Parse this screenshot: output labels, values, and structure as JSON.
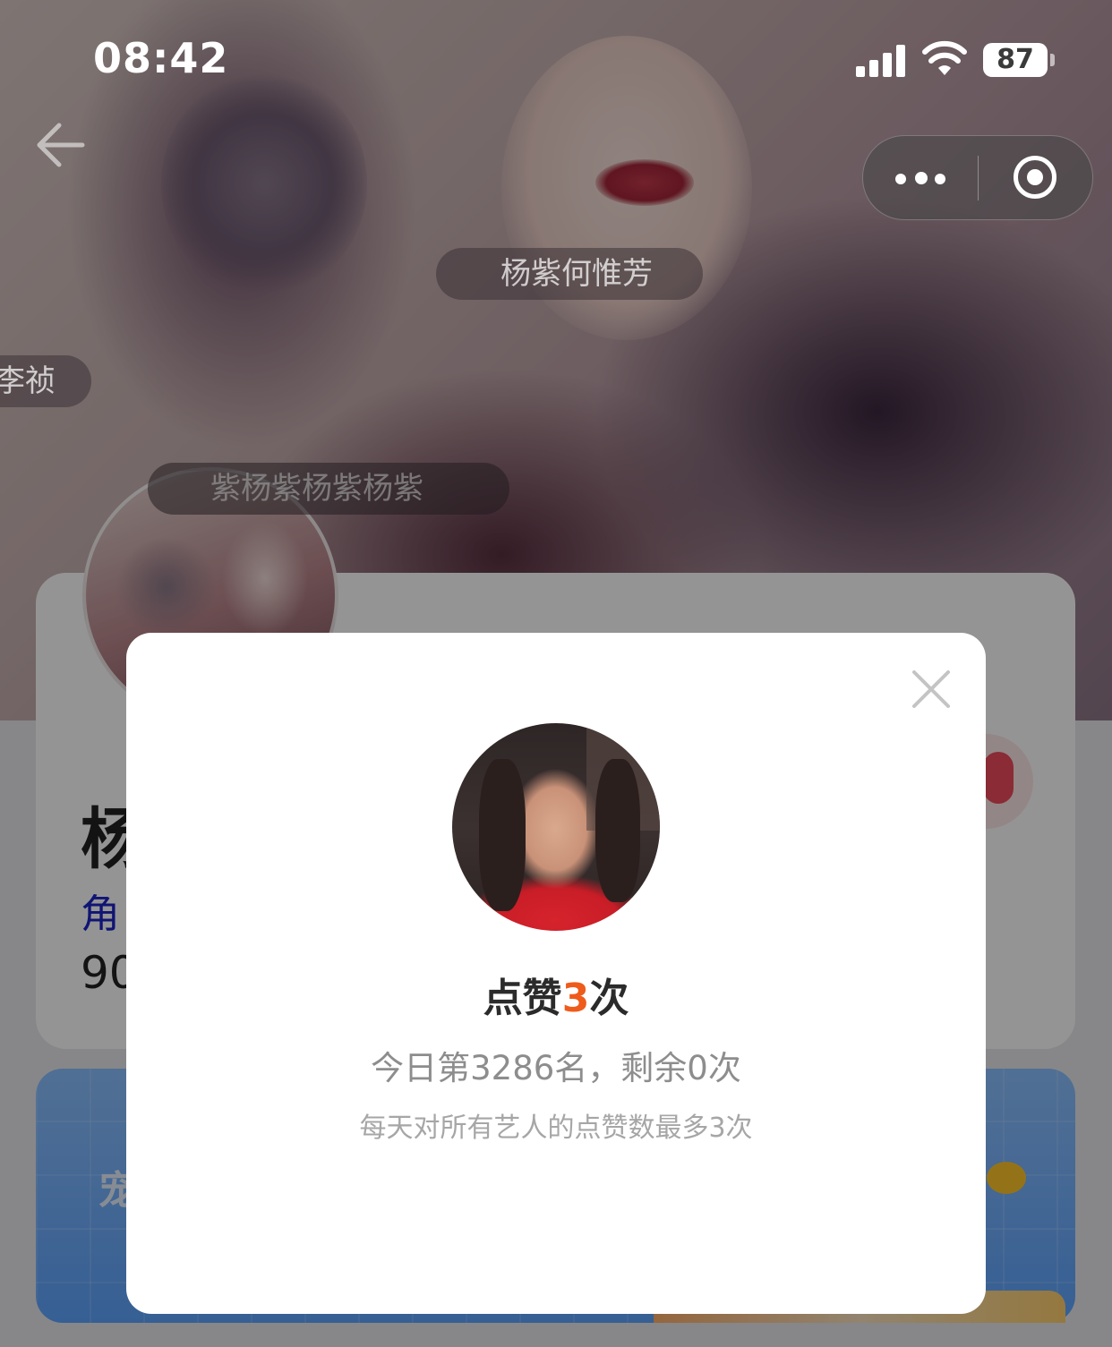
{
  "status_bar": {
    "time": "08:42",
    "battery": "87"
  },
  "danmaku": [
    "杨紫何惟芳",
    "李祯",
    "紫杨紫杨紫杨紫"
  ],
  "profile": {
    "name_partial": "杨",
    "role_partial": "角",
    "count_partial": "90"
  },
  "banner": {
    "text_partial": "宠"
  },
  "modal": {
    "title_prefix": "点赞",
    "title_count": "3",
    "title_suffix": "次",
    "rank_text": "今日第3286名，剩余0次",
    "hint_text": "每天对所有艺人的点赞数最多3次"
  },
  "colors": {
    "accent": "#ef5b1a",
    "role_link": "#1c23c9",
    "overlay": "rgba(0,0,0,0.42)"
  },
  "icons": [
    "back-arrow-icon",
    "more-dots-icon",
    "target-icon",
    "close-icon",
    "signal-icon",
    "wifi-icon",
    "battery-icon"
  ]
}
